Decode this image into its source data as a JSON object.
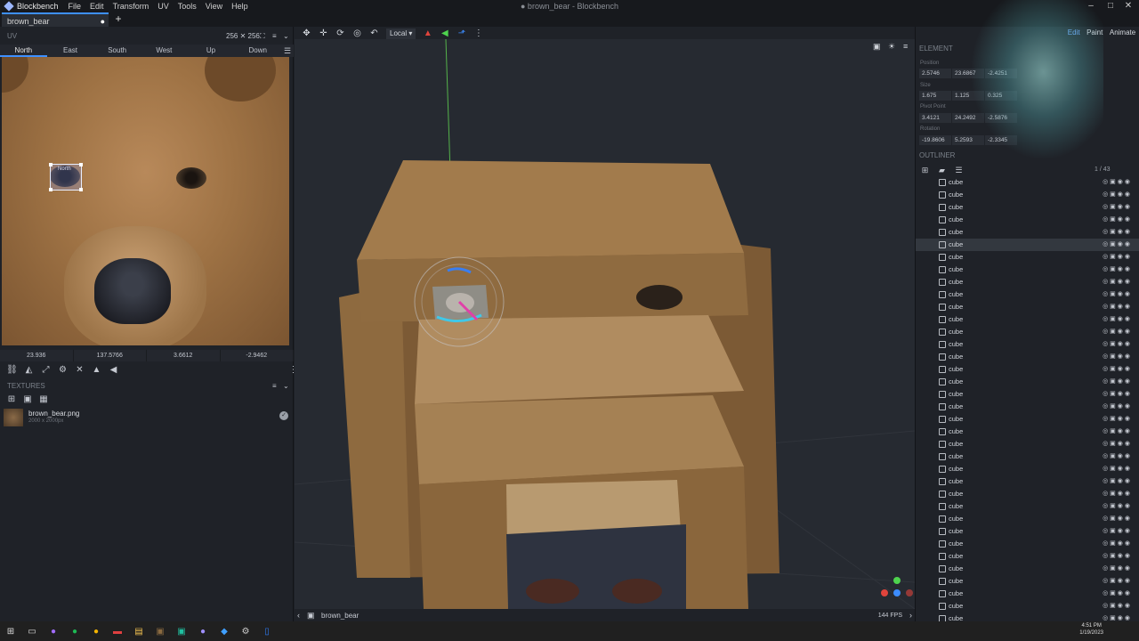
{
  "app": {
    "name": "Blockbench",
    "window_title": "● brown_bear - Blockbench",
    "menu": [
      "File",
      "Edit",
      "Transform",
      "UV",
      "Tools",
      "View",
      "Help"
    ]
  },
  "tab": {
    "label": "brown_bear",
    "modified_dot": "●",
    "new_tab": "+"
  },
  "uv_panel": {
    "header": "UV",
    "size": "256 ✕ 256",
    "faces": [
      "North",
      "East",
      "South",
      "West",
      "Up",
      "Down"
    ],
    "active_face": "North",
    "selection_label": "North",
    "coords": [
      "23.936",
      "137.5766",
      "3.6612",
      "-2.9462"
    ]
  },
  "textures": {
    "header": "TEXTURES",
    "items": [
      {
        "name": "brown_bear.png",
        "size": "2000 x 2000px"
      }
    ]
  },
  "viewport": {
    "space_dropdown": "Local",
    "model_name": "brown_bear",
    "fps": "144 FPS"
  },
  "modes": [
    "Edit",
    "Paint",
    "Animate"
  ],
  "active_mode": "Edit",
  "element": {
    "header": "ELEMENT",
    "position_label": "Position",
    "position": [
      "2.5746",
      "23.6867",
      "-2.4251"
    ],
    "size_label": "Size",
    "size": [
      "1.675",
      "1.125",
      "0.325"
    ],
    "pivot_label": "Pivot Point",
    "pivot": [
      "3.4121",
      "24.2492",
      "-2.5876"
    ],
    "rotation_label": "Rotation",
    "rotation": [
      "-19.8606",
      "5.2593",
      "-2.3345"
    ]
  },
  "outliner": {
    "header": "OUTLINER",
    "count": "1 / 43",
    "items": [
      "cube",
      "cube",
      "cube",
      "cube",
      "cube",
      "cube",
      "cube",
      "cube",
      "cube",
      "cube",
      "cube",
      "cube",
      "cube",
      "cube",
      "cube",
      "cube",
      "cube",
      "cube",
      "cube",
      "cube",
      "cube",
      "cube",
      "cube",
      "cube",
      "cube",
      "cube",
      "cube",
      "cube",
      "cube",
      "cube",
      "cube",
      "cube",
      "cube",
      "cube",
      "cube",
      "cube"
    ],
    "selected_index": 5
  },
  "taskbar": {
    "time": "4:51 PM",
    "date": "1/19/2023"
  }
}
